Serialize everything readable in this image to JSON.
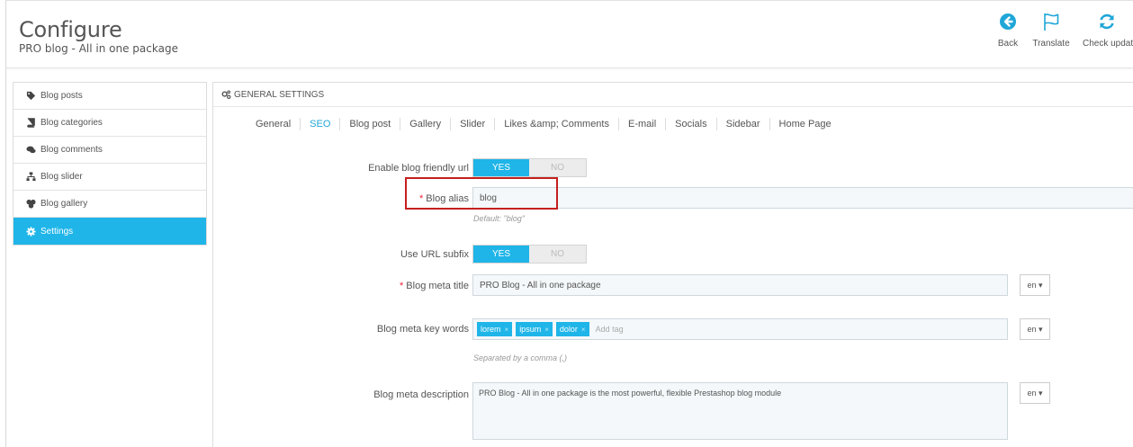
{
  "header": {
    "title": "Configure",
    "subtitle": "PRO blog - All in one package"
  },
  "toolbar": {
    "back_label": "Back",
    "translate_label": "Translate",
    "check_label": "Check update",
    "accent": "#1fa6d8"
  },
  "sidebar": {
    "items": [
      {
        "label": "Blog posts",
        "icon": "tags-icon"
      },
      {
        "label": "Blog categories",
        "icon": "book-icon"
      },
      {
        "label": "Blog comments",
        "icon": "comments-icon"
      },
      {
        "label": "Blog slider",
        "icon": "sitemap-icon"
      },
      {
        "label": "Blog gallery",
        "icon": "gallery-icon"
      },
      {
        "label": "Settings",
        "icon": "gear-icon",
        "active": true
      }
    ],
    "active_color": "#1fb5e8"
  },
  "panel": {
    "heading": "GENERAL SETTINGS",
    "tabs": [
      {
        "label": "General"
      },
      {
        "label": "SEO",
        "active": true
      },
      {
        "label": "Blog post"
      },
      {
        "label": "Gallery"
      },
      {
        "label": "Slider"
      },
      {
        "label": "Likes &amp; Comments"
      },
      {
        "label": "E-mail"
      },
      {
        "label": "Socials"
      },
      {
        "label": "Sidebar"
      },
      {
        "label": "Home Page"
      }
    ]
  },
  "form": {
    "friendly_url": {
      "label": "Enable blog friendly url",
      "yes": "YES",
      "no": "NO"
    },
    "alias": {
      "required": "*",
      "label": "Blog alias",
      "value": "blog",
      "help": "Default: \"blog\""
    },
    "url_subfix": {
      "label": "Use URL subfix",
      "yes": "YES",
      "no": "NO"
    },
    "meta_title": {
      "required": "*",
      "label": "Blog meta title",
      "value": "PRO Blog - All in one package",
      "lang": "en"
    },
    "meta_keywords": {
      "label": "Blog meta key words",
      "tags": [
        "lorem",
        "ipsum",
        "dolor"
      ],
      "placeholder": "Add tag",
      "help": "Separated by a comma (,)",
      "lang": "en"
    },
    "meta_description": {
      "label": "Blog meta description",
      "value": "PRO Blog - All in one package is the most powerful, flexible Prestashop blog module",
      "lang": "en"
    }
  }
}
